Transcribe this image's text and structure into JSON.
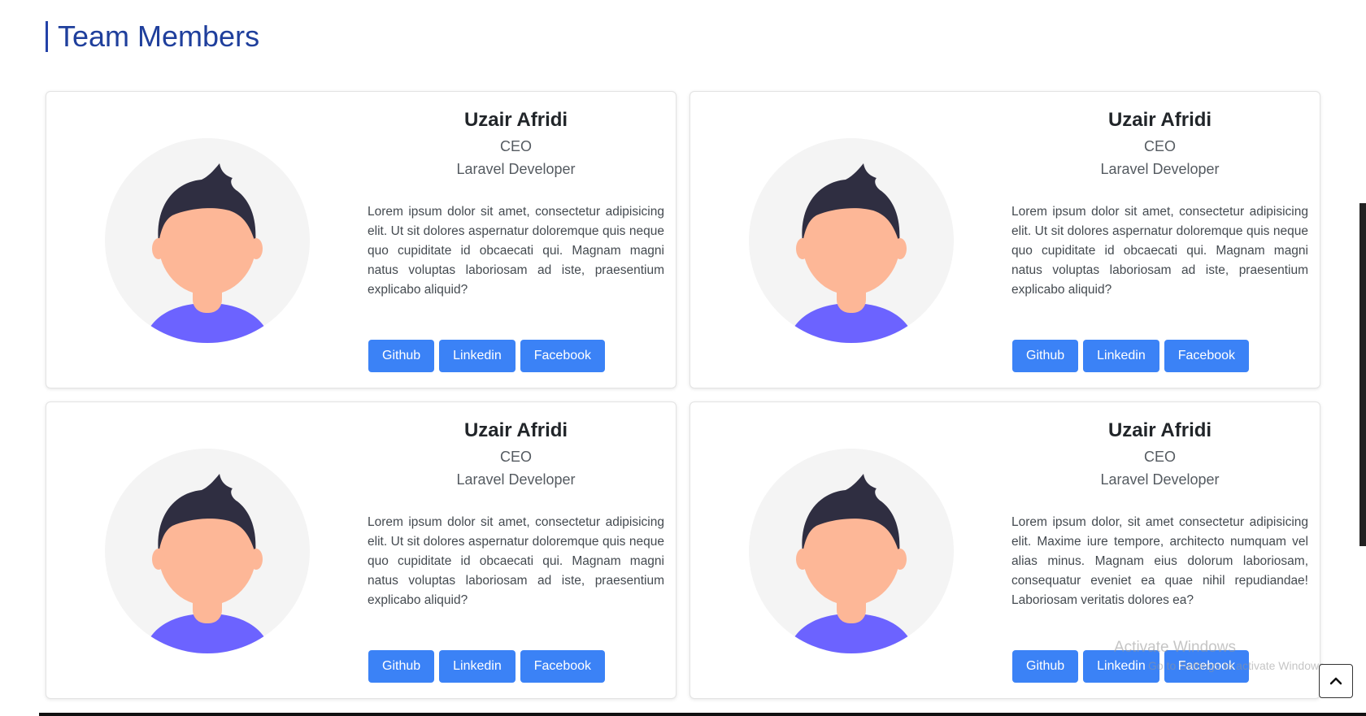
{
  "section": {
    "title": "Team Members"
  },
  "members": [
    {
      "name": "Uzair Afridi",
      "role": "CEO",
      "specialty": "Laravel Developer",
      "bio": "Lorem ipsum dolor sit amet, consectetur adipisicing elit. Ut sit dolores aspernatur doloremque quis neque quo cupiditate id obcaecati qui. Magnam magni natus voluptas laboriosam ad iste, praesentium explicabo aliquid?",
      "buttons": [
        "Github",
        "Linkedin",
        "Facebook"
      ]
    },
    {
      "name": "Uzair Afridi",
      "role": "CEO",
      "specialty": "Laravel Developer",
      "bio": "Lorem ipsum dolor sit amet, consectetur adipisicing elit. Ut sit dolores aspernatur doloremque quis neque quo cupiditate id obcaecati qui. Magnam magni natus voluptas laboriosam ad iste, praesentium explicabo aliquid?",
      "buttons": [
        "Github",
        "Linkedin",
        "Facebook"
      ]
    },
    {
      "name": "Uzair Afridi",
      "role": "CEO",
      "specialty": "Laravel Developer",
      "bio": "Lorem ipsum dolor sit amet, consectetur adipisicing elit. Ut sit dolores aspernatur doloremque quis neque quo cupiditate id obcaecati qui. Magnam magni natus voluptas laboriosam ad iste, praesentium explicabo aliquid?",
      "buttons": [
        "Github",
        "Linkedin",
        "Facebook"
      ]
    },
    {
      "name": "Uzair Afridi",
      "role": "CEO",
      "specialty": "Laravel Developer",
      "bio": "Lorem ipsum dolor, sit amet consectetur adipisicing elit. Maxime iure tempore, architecto numquam vel alias minus. Magnam eius dolorum laboriosam, consequatur eveniet ea quae nihil repudiandae! Laboriosam veritatis dolores ea?",
      "buttons": [
        "Github",
        "Linkedin",
        "Facebook"
      ]
    }
  ],
  "watermark": {
    "line1": "Activate Windows",
    "line2": "Go to Settings to activate Windows."
  },
  "icons": {
    "scroll_top": "chevron-up-icon",
    "avatar": "user-avatar-icon"
  },
  "colors": {
    "accent": "#3b82f6",
    "title": "#1f3f9c",
    "avatar_bg": "#f4f4f4",
    "shirt": "#6c63ff",
    "skin": "#fdb797",
    "hair": "#2f2e41"
  }
}
